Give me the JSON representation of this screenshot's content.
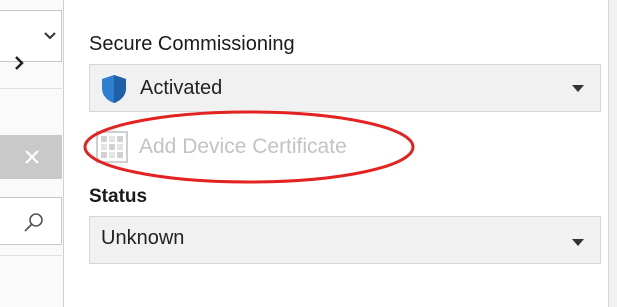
{
  "left_pane": {
    "dropdown_icon": "chevron-down-icon",
    "expand_icon": "chevron-right-icon",
    "close_icon": "close-icon",
    "search_icon": "search-icon"
  },
  "secure_commissioning": {
    "label": "Secure Commissioning",
    "selected_value": "Activated",
    "value_icon": "shield-icon",
    "dropdown_icon": "caret-down-icon",
    "shield_color": "#2e7fd0"
  },
  "add_certificate": {
    "label": "Add Device Certificate",
    "icon": "certificate-grid-icon",
    "state": "disabled",
    "annotation_color": "#e32222"
  },
  "status": {
    "label": "Status",
    "selected_value": "Unknown",
    "dropdown_icon": "caret-down-icon"
  }
}
